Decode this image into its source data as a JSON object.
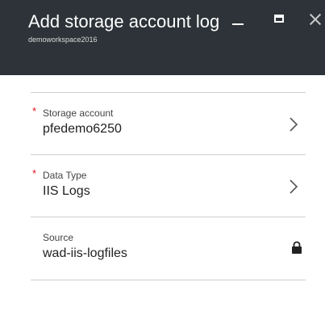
{
  "header": {
    "title": "Add storage account log",
    "subtitle": "demoworkspace2016"
  },
  "window_controls": {
    "minimize": "minimize",
    "maximize": "maximize",
    "close": "close"
  },
  "fields": [
    {
      "label": "Storage account",
      "value": "pfedemo6250",
      "required": true,
      "required_marker": "*",
      "trailing_icon": "chevron-right-icon"
    },
    {
      "label": "Data Type",
      "value": "IIS Logs",
      "required": true,
      "required_marker": "*",
      "trailing_icon": "chevron-right-icon"
    },
    {
      "label": "Source",
      "value": "wad-iis-logfiles",
      "required": false,
      "trailing_icon": "lock-icon"
    }
  ],
  "colors": {
    "header_bg": "#2d3338",
    "required": "#e81123",
    "divider": "#d0d0d0"
  }
}
